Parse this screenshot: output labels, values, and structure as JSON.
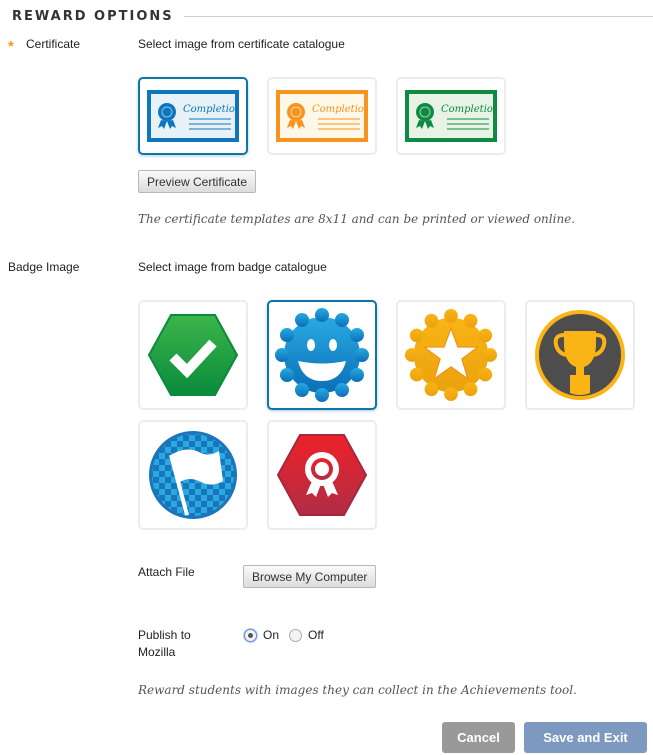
{
  "section": {
    "title": "REWARD OPTIONS"
  },
  "certificate": {
    "label": "Certificate",
    "required": true,
    "instruction": "Select image from certificate catalogue",
    "options": [
      {
        "name": "blue-certificate",
        "text": "Completion",
        "color": "#0f75bc",
        "bg": "#e6f2f8",
        "selected": true
      },
      {
        "name": "orange-certificate",
        "text": "Completion",
        "color": "#f7941d",
        "bg": "#fdf8e8",
        "selected": false
      },
      {
        "name": "green-certificate",
        "text": "Completion",
        "color": "#0e8a43",
        "bg": "#e8f3e6",
        "selected": false
      }
    ],
    "preview_button": "Preview Certificate",
    "hint": "The certificate templates are 8x11 and can be printed or viewed online."
  },
  "badge": {
    "label": "Badge Image",
    "instruction": "Select image from badge catalogue",
    "options": [
      {
        "name": "green-checkmark-badge",
        "selected": false
      },
      {
        "name": "blue-smiley-badge",
        "selected": true
      },
      {
        "name": "gold-star-badge",
        "selected": false
      },
      {
        "name": "trophy-badge",
        "selected": false
      },
      {
        "name": "checkered-flag-badge",
        "selected": false
      },
      {
        "name": "red-ribbon-badge",
        "selected": false
      }
    ]
  },
  "attach": {
    "label": "Attach File",
    "button": "Browse My Computer"
  },
  "publish": {
    "label_line1": "Publish to",
    "label_line2": "Mozilla",
    "options": [
      "On",
      "Off"
    ],
    "selected": "On"
  },
  "footer_hint": "Reward students with images they can collect in the Achievements tool.",
  "actions": {
    "cancel": "Cancel",
    "save": "Save and Exit"
  }
}
